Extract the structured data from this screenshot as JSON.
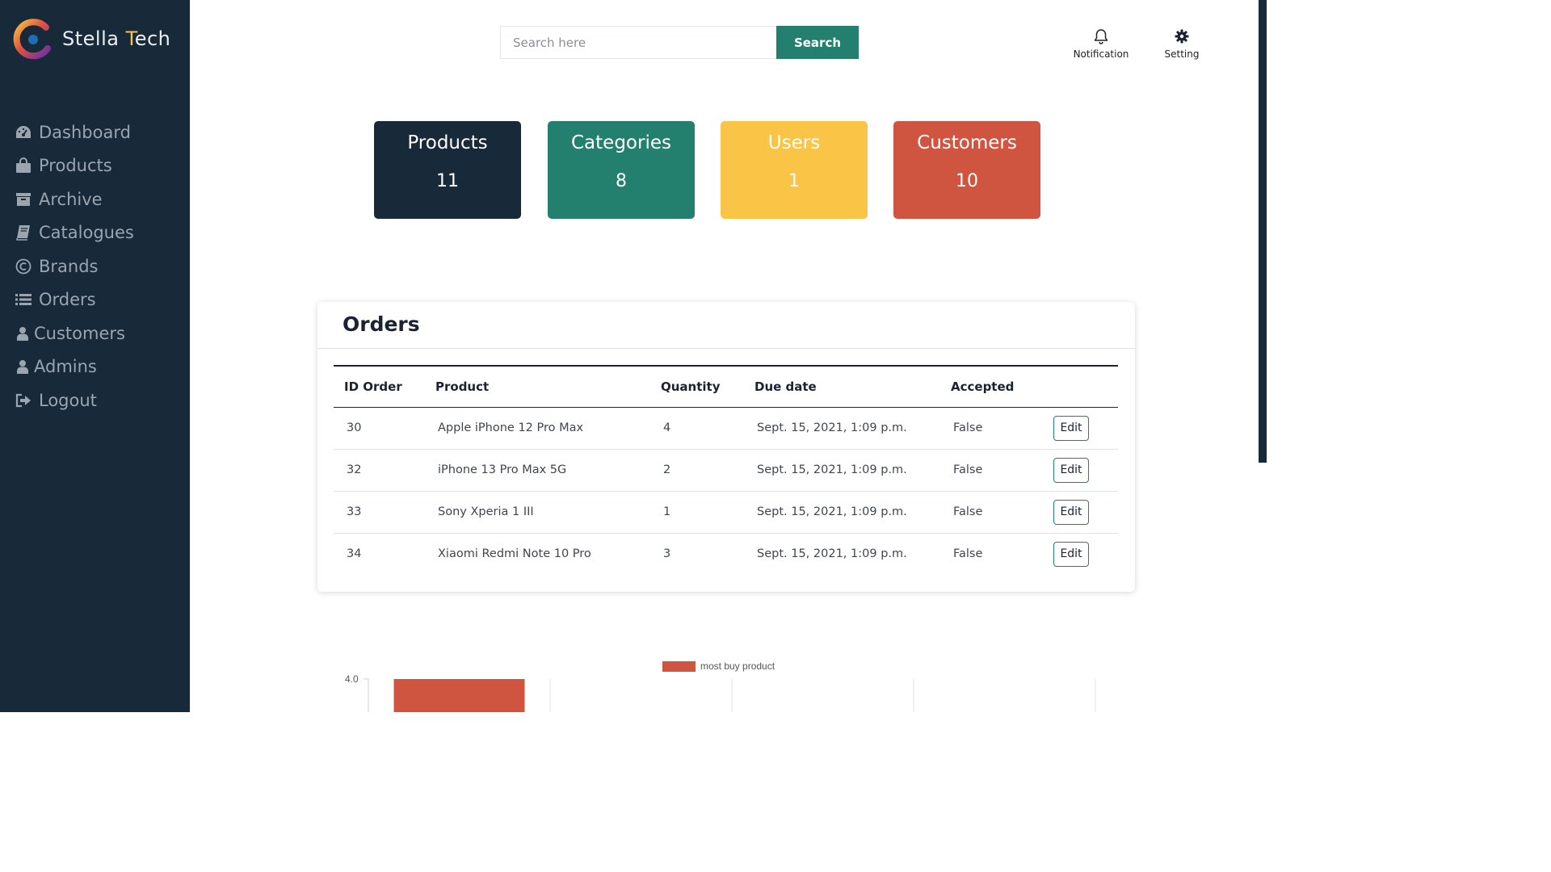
{
  "brand": {
    "name_part1": "Stella ",
    "name_part2": "T",
    "name_part3": "ech"
  },
  "sidebar": {
    "items": [
      {
        "label": "Dashboard",
        "icon": "dashboard-icon"
      },
      {
        "label": "Products",
        "icon": "shopping-bag-icon"
      },
      {
        "label": "Archive",
        "icon": "archive-icon"
      },
      {
        "label": "Catalogues",
        "icon": "book-icon"
      },
      {
        "label": "Brands",
        "icon": "copyright-icon"
      },
      {
        "label": "Orders",
        "icon": "list-icon"
      },
      {
        "label": "Customers",
        "icon": "user-icon"
      },
      {
        "label": "Admins",
        "icon": "user-icon"
      },
      {
        "label": "Logout",
        "icon": "sign-out-icon"
      }
    ]
  },
  "header": {
    "search_placeholder": "Search here",
    "search_button": "Search",
    "notification_label": "Notification",
    "setting_label": "Setting"
  },
  "stats": {
    "products": {
      "title": "Products",
      "value": "11"
    },
    "categories": {
      "title": "Categories",
      "value": "8"
    },
    "users": {
      "title": "Users",
      "value": "1"
    },
    "customers": {
      "title": "Customers",
      "value": "10"
    }
  },
  "orders": {
    "title": "Orders",
    "columns": [
      "ID Order",
      "Product",
      "Quantity",
      "Due date",
      "Accepted"
    ],
    "edit_label": "Edit",
    "rows": [
      {
        "id": "30",
        "product": "Apple iPhone 12 Pro Max",
        "quantity": "4",
        "due": "Sept. 15, 2021, 1:09 p.m.",
        "accepted": "False"
      },
      {
        "id": "32",
        "product": "iPhone 13 Pro Max 5G",
        "quantity": "2",
        "due": "Sept. 15, 2021, 1:09 p.m.",
        "accepted": "False"
      },
      {
        "id": "33",
        "product": "Sony Xperia 1 III",
        "quantity": "1",
        "due": "Sept. 15, 2021, 1:09 p.m.",
        "accepted": "False"
      },
      {
        "id": "34",
        "product": "Xiaomi Redmi Note 10 Pro",
        "quantity": "3",
        "due": "Sept. 15, 2021, 1:09 p.m.",
        "accepted": "False"
      }
    ]
  },
  "colors": {
    "sidebar": "#18293a",
    "accent": "#23806f",
    "yellow": "#fac546",
    "red": "#d05541"
  },
  "chart_data": {
    "type": "bar",
    "series": [
      {
        "name": "most buy product",
        "color": "#d05541"
      }
    ],
    "y_tick_top": "4.0",
    "first_bar_value": 4,
    "bar_count_visible": 1,
    "columns_visible": 4
  }
}
